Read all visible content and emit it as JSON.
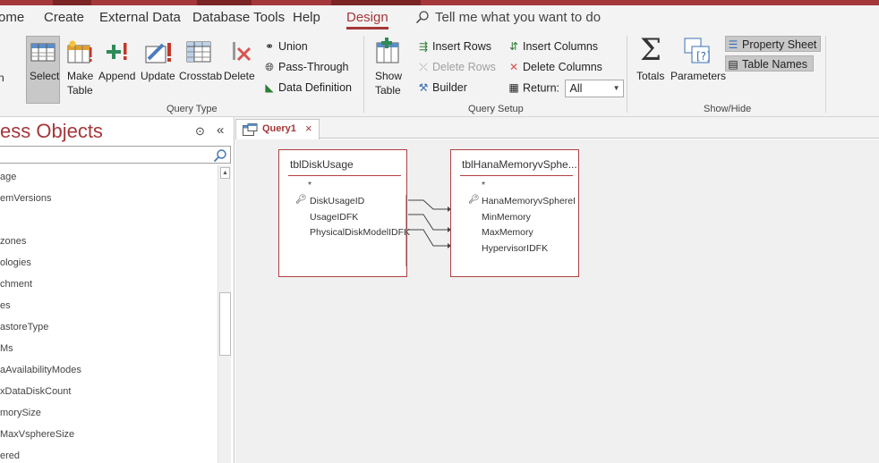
{
  "ribbon_tabs": {
    "home": "ome",
    "create": "Create",
    "external_data": "External Data",
    "database_tools": "Database Tools",
    "help": "Help",
    "design": "Design",
    "tell_me": "Tell me what you want to do"
  },
  "query_type": {
    "run_partial": "n",
    "select": "Select",
    "make_table": "Make\nTable",
    "make_table_l1": "Make",
    "make_table_l2": "Table",
    "append": "Append",
    "update": "Update",
    "crosstab": "Crosstab",
    "delete": "Delete",
    "union": "Union",
    "pass_through": "Pass-Through",
    "data_definition": "Data Definition",
    "group_label": "Query Type"
  },
  "query_setup": {
    "show_table_l1": "Show",
    "show_table_l2": "Table",
    "insert_rows": "Insert Rows",
    "delete_rows": "Delete Rows",
    "builder": "Builder",
    "insert_columns": "Insert Columns",
    "delete_columns": "Delete Columns",
    "return_label": "Return:",
    "return_value": "All",
    "group_label": "Query Setup"
  },
  "show_hide": {
    "totals": "Totals",
    "parameters": "Parameters",
    "property_sheet": "Property Sheet",
    "table_names": "Table Names",
    "group_label": "Show/Hide"
  },
  "nav_pane": {
    "title": "ess Objects",
    "items": [
      "age",
      "emVersions",
      "",
      "zones",
      "ologies",
      "chment",
      "es",
      "astoreType",
      "Ms",
      "aAvailabilityModes",
      "xDataDiskCount",
      "morySize",
      "MaxVsphereSize",
      "ered"
    ]
  },
  "document_tab": {
    "label": "Query1"
  },
  "tables": [
    {
      "name": "tblDiskUsage",
      "star": "*",
      "fields": [
        "DiskUsageID",
        "UsageIDFK",
        "PhysicalDiskModelIDFK"
      ]
    },
    {
      "name": "tblHanaMemoryvSphe...",
      "star": "*",
      "fields": [
        "HanaMemoryvSphereI",
        "MinMemory",
        "MaxMemory",
        "HypervisorIDFK"
      ]
    }
  ],
  "colors": {
    "accent": "#a4373a",
    "ribbon_bg": "#f3f3f3",
    "canvas_bg": "#f0f0f0"
  }
}
